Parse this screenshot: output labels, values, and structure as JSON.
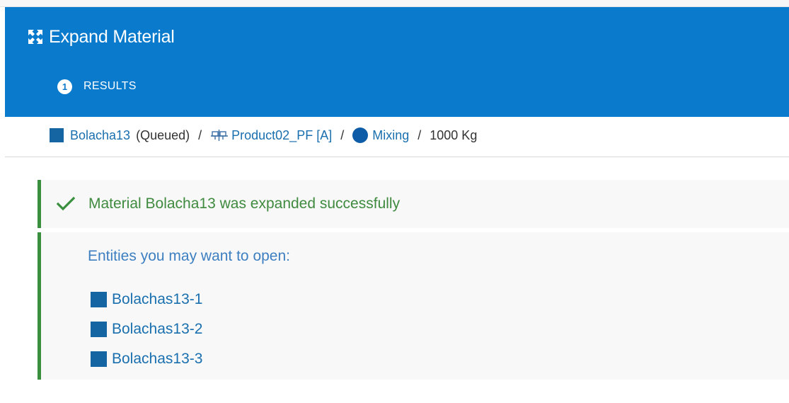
{
  "header": {
    "title": "Expand Material",
    "title_icon": "expand-arrows-icon",
    "step": {
      "number": "1",
      "label": "RESULTS"
    }
  },
  "breadcrumb": {
    "material": {
      "name": "Bolacha13",
      "status": "(Queued)",
      "icon": "material-square-icon"
    },
    "product": {
      "name": "Product02_PF [A]",
      "icon": "product-icon"
    },
    "step": {
      "name": "Mixing",
      "icon": "step-circle-icon"
    },
    "quantity": "1000 Kg",
    "separator": "/"
  },
  "result": {
    "message": "Material Bolacha13 was expanded successfully",
    "icon": "check-icon"
  },
  "entities": {
    "title": "Entities you may want to open:",
    "items": [
      {
        "label": "Bolachas13-1"
      },
      {
        "label": "Bolachas13-2"
      },
      {
        "label": "Bolachas13-3"
      }
    ]
  },
  "colors": {
    "header_bg": "#0a7acc",
    "success_green": "#3a8f3e",
    "link_blue": "#1a6fae",
    "material_icon": "#1565a3"
  }
}
